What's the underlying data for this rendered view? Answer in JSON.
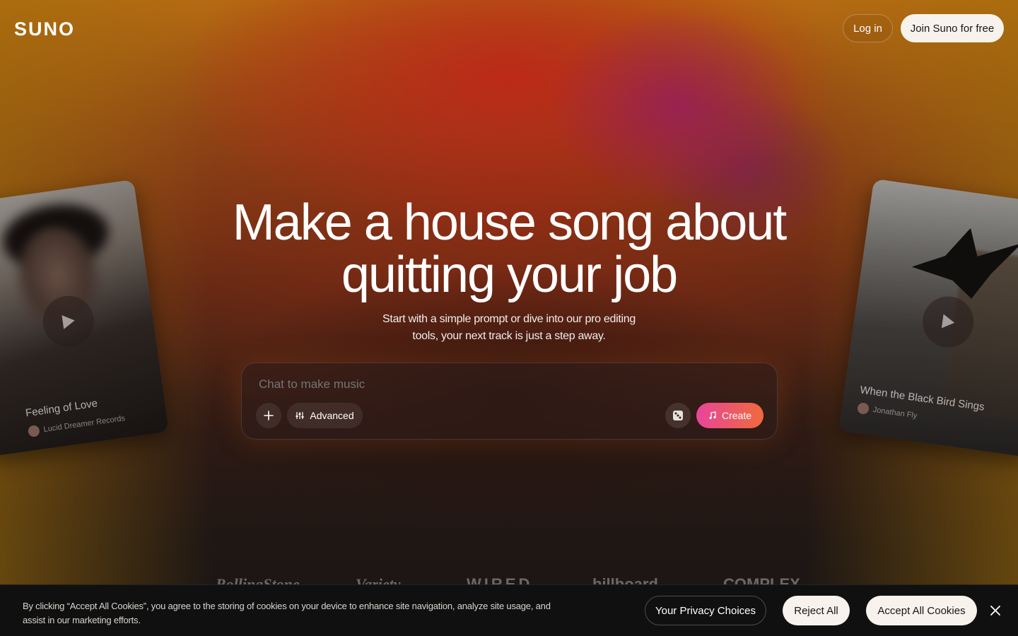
{
  "header": {
    "logo": "SUNO",
    "login_label": "Log in",
    "join_label": "Join Suno for free"
  },
  "hero": {
    "title_line1": "Make a house song about",
    "title_line2": "quitting your job",
    "subtitle_line1": "Start with a simple prompt or dive into our pro editing",
    "subtitle_line2": "tools, your next track is just a step away."
  },
  "prompt": {
    "placeholder": "Chat to make music",
    "advanced_label": "Advanced",
    "create_label": "Create"
  },
  "cards": [
    {
      "title": "Feeling of Love",
      "artist": "Lucid Dreamer Records"
    },
    {
      "title": "When the Black Bird Sings",
      "artist": "Jonathan Fly"
    }
  ],
  "press": [
    "RollingStone",
    "Variety",
    "WIRED",
    "billboard",
    "COMPLEX"
  ],
  "cookie": {
    "text": "By clicking “Accept All Cookies”, you agree to the storing of cookies on your device to enhance site navigation, analyze site usage, and assist in our marketing efforts.",
    "privacy_label": "Your Privacy Choices",
    "reject_label": "Reject All",
    "accept_label": "Accept All Cookies"
  },
  "colors": {
    "accent_gradient_start": "#e8459a",
    "accent_gradient_end": "#f06a3b",
    "button_light": "#f7f3ec"
  }
}
